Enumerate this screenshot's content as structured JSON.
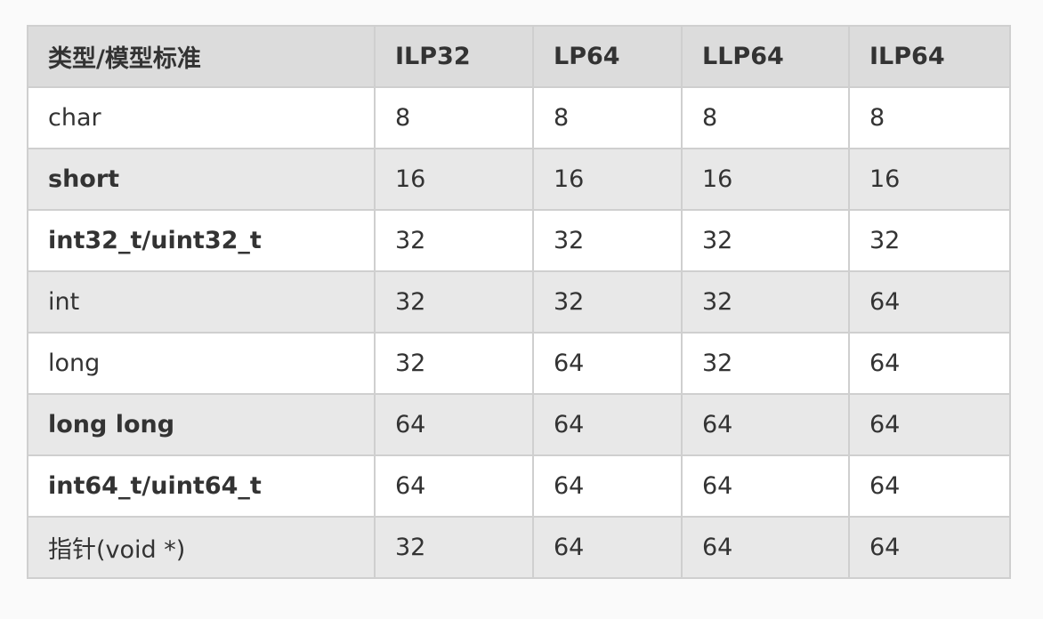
{
  "table": {
    "headers": [
      "类型/模型标准",
      "ILP32",
      "LP64",
      "LLP64",
      "ILP64"
    ],
    "rows": [
      {
        "type": "char",
        "bold": false,
        "values": [
          "8",
          "8",
          "8",
          "8"
        ]
      },
      {
        "type": "short",
        "bold": true,
        "values": [
          "16",
          "16",
          "16",
          "16"
        ]
      },
      {
        "type": "int32_t/uint32_t",
        "bold": true,
        "values": [
          "32",
          "32",
          "32",
          "32"
        ]
      },
      {
        "type": "int",
        "bold": false,
        "values": [
          "32",
          "32",
          "32",
          "64"
        ]
      },
      {
        "type": "long",
        "bold": false,
        "values": [
          "32",
          "64",
          "32",
          "64"
        ]
      },
      {
        "type": "long long",
        "bold": true,
        "values": [
          "64",
          "64",
          "64",
          "64"
        ]
      },
      {
        "type": "int64_t/uint64_t",
        "bold": true,
        "values": [
          "64",
          "64",
          "64",
          "64"
        ]
      },
      {
        "type": "指针(void *)",
        "bold": false,
        "values": [
          "32",
          "64",
          "64",
          "64"
        ]
      }
    ]
  }
}
